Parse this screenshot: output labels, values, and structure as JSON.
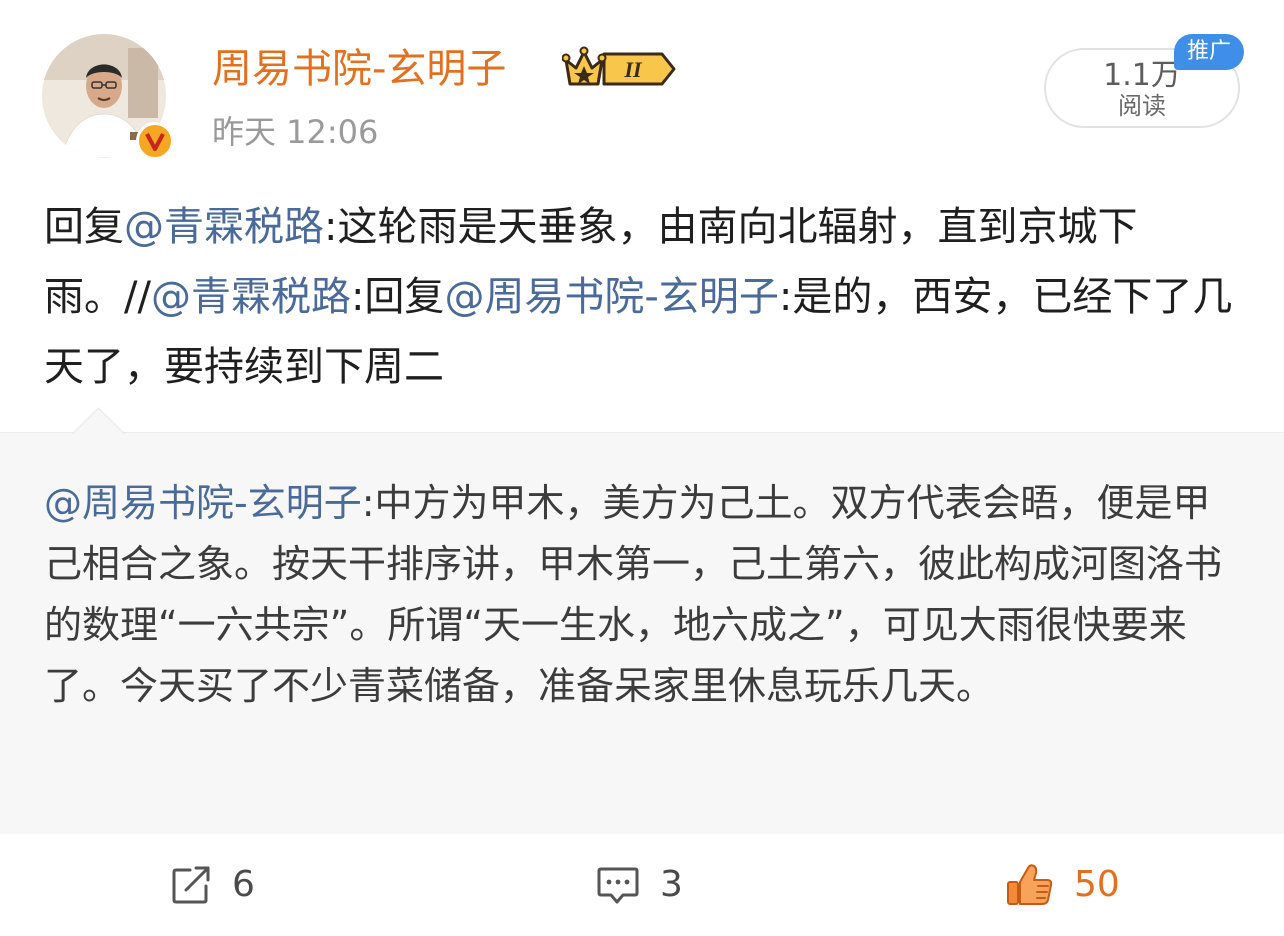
{
  "author": {
    "name": "周易书院-玄明子",
    "time": "昨天 12:06",
    "avatar_icon": "avatar-photo",
    "verified_icon": "verified-v-icon",
    "level_badge": {
      "icon": "crown-level-icon",
      "level": "II"
    }
  },
  "stats": {
    "read_count": "1.1万",
    "read_label": "阅读",
    "promo_label": "推广"
  },
  "reply": {
    "p1": "回复",
    "m1": "@青霖税路",
    "p2": ":这轮雨是天垂象，由南向北辐射，直到京城下雨。//",
    "m2": "@青霖税路",
    "p3": ":回复",
    "m3": "@周易书院-玄明子",
    "p4": ":是的，西安，已经下了几天了，要持续到下周二"
  },
  "quoted": {
    "mention": "@周易书院-玄明子",
    "text": ":中方为甲木，美方为己土。双方代表会晤，便是甲己相合之象。按天干排序讲，甲木第一，己土第六，彼此构成河图洛书的数理“一六共宗”。所谓“天一生水，地六成之”，可见大雨很快要来了。今天买了不少青菜储备，准备呆家里休息玩乐几天。"
  },
  "actions": {
    "repost": {
      "icon": "repost-icon",
      "count": "6"
    },
    "comment": {
      "icon": "comment-icon",
      "count": "3"
    },
    "like": {
      "icon": "thumbs-up-icon",
      "count": "50"
    }
  },
  "colors": {
    "name_orange": "#e3701e",
    "mention_blue": "#4a6a99",
    "promo_blue": "#3f8fe8",
    "like_orange": "#e3701e",
    "quote_bg": "#f7f7f7"
  }
}
